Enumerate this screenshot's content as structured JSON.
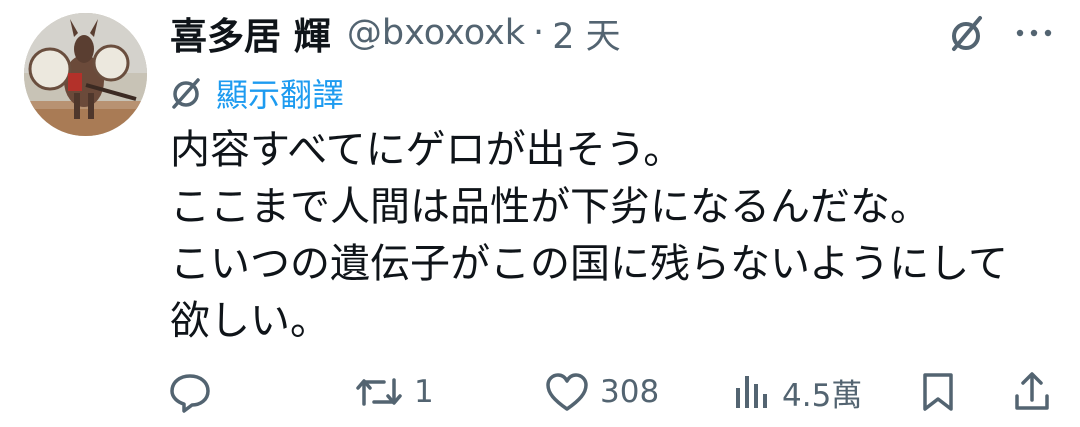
{
  "tweet": {
    "author": {
      "display_name": "喜多居 輝",
      "handle": "@bxoxoxk",
      "separator": "·",
      "time": "2 天"
    },
    "translate_label": "顯示翻譯",
    "body_lines": [
      "内容すべてにゲロが出そう。",
      "ここまで人間は品性が下劣になるんだな。",
      "こいつの遺伝子がこの国に残らないようにして",
      "欲しい。"
    ],
    "actions": {
      "reply_count": "",
      "retweet_count": "1",
      "like_count": "308",
      "views_count": "4.5萬"
    }
  },
  "icons": {
    "grok": "grok-icon",
    "more": "more-icon",
    "translate": "translate-icon",
    "reply": "reply-icon",
    "retweet": "retweet-icon",
    "like": "heart-icon",
    "views": "views-icon",
    "bookmark": "bookmark-icon",
    "share": "share-icon"
  },
  "colors": {
    "text_primary": "#0f1419",
    "text_secondary": "#536471",
    "link_blue": "#1d9bf0"
  }
}
